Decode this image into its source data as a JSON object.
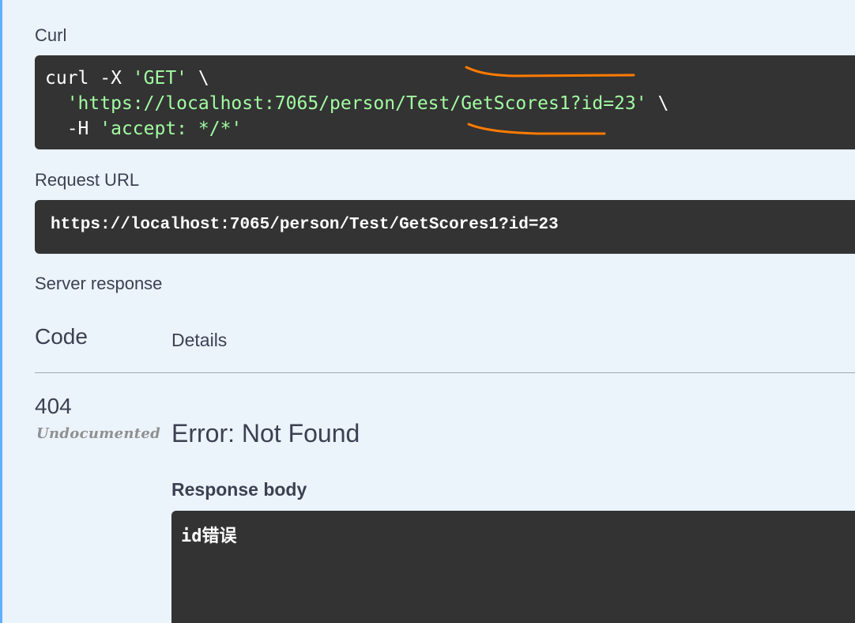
{
  "curl": {
    "label": "Curl",
    "line1_prefix": "curl -X ",
    "line1_method": "'GET'",
    "line1_suffix": " \\",
    "line2_indent": "  ",
    "line2_url": "'https://localhost:7065/person/Test/GetScores1?id=23'",
    "line2_suffix": " \\",
    "line3_prefix": "  -H ",
    "line3_header": "'accept: */*'"
  },
  "request_url": {
    "label": "Request URL",
    "value": "https://localhost:7065/person/Test/GetScores1?id=23"
  },
  "server_response": {
    "label": "Server response",
    "col_code": "Code",
    "col_details": "Details",
    "status_code": "404",
    "undocumented": "Undocumented",
    "error_title": "Error: Not Found",
    "body_label": "Response body",
    "body_value": "id错误"
  },
  "colors": {
    "background": "#ebf3fb",
    "accent_border": "#61affe",
    "code_bg": "#333333",
    "string_green": "#a2fca2",
    "annotation_orange": "#ff7b00"
  }
}
